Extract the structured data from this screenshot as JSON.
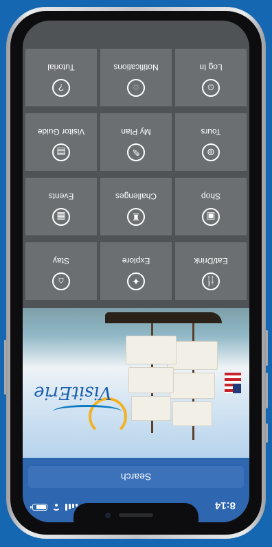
{
  "status": {
    "time": "8:14"
  },
  "search": {
    "label": "Search"
  },
  "hero": {
    "logo_text": "VisitErie"
  },
  "tiles": [
    {
      "label": "Eat/Drink",
      "icon": "plate-icon",
      "glyph": "🍴"
    },
    {
      "label": "Explore",
      "icon": "compass-icon",
      "glyph": "✦"
    },
    {
      "label": "Stay",
      "icon": "bed-icon",
      "glyph": "⌂"
    },
    {
      "label": "Shop",
      "icon": "bag-icon",
      "glyph": "▣"
    },
    {
      "label": "Challenges",
      "icon": "trophy-icon",
      "glyph": "♜"
    },
    {
      "label": "Events",
      "icon": "calendar-icon",
      "glyph": "▦"
    },
    {
      "label": "Tours",
      "icon": "bus-icon",
      "glyph": "⊚"
    },
    {
      "label": "My Plan",
      "icon": "pen-icon",
      "glyph": "✎"
    },
    {
      "label": "Visitor Guide",
      "icon": "book-icon",
      "glyph": "▤"
    },
    {
      "label": "Log In",
      "icon": "user-icon",
      "glyph": "☺"
    },
    {
      "label": "Notifications",
      "icon": "chat-icon",
      "glyph": "◌"
    },
    {
      "label": "Tutorial",
      "icon": "question-icon",
      "glyph": "?"
    }
  ]
}
